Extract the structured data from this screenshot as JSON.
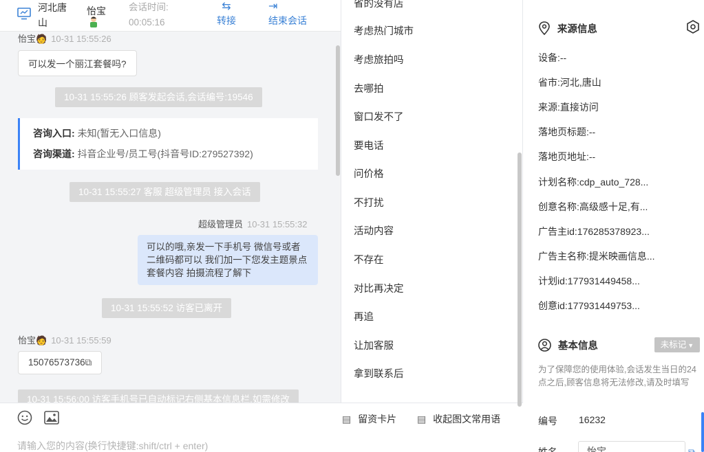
{
  "topbar": {
    "location": "河北唐山",
    "visitor_name": "怡宝",
    "session_time_label": "会话时间:",
    "session_time_value": "00:05:16",
    "transfer_label": "转接",
    "end_label": "结束会话"
  },
  "chat": {
    "msg1_sender": "怡宝",
    "msg1_time": "10-31 15:55:26",
    "msg1_text": "可以发一个丽江套餐吗?",
    "sys1": "10-31 15:55:26 顾客发起会话,会话编号:19546",
    "info_entry_label": "咨询入口:",
    "info_entry_value": "未知(暂无入口信息)",
    "info_channel_label": "咨询渠道:",
    "info_channel_value": "抖音企业号/员工号(抖音号ID:279527392)",
    "sys2": "10-31 15:55:27 客服 超级管理员 接入会话",
    "agent_name": "超级管理员",
    "agent_time": "10-31 15:55:32",
    "agent_text": "可以的哦,亲发一下手机号 微信号或者二维码都可以 我们加一下您发主题景点 套餐内容 拍摄流程了解下",
    "sys3": "10-31 15:55:52 访客已离开",
    "msg2_sender": "怡宝",
    "msg2_time": "10-31 15:55:59",
    "msg2_text": "15076573736",
    "sys4": "10-31 15:56:00 访客手机号已自动标记右侧基本信息栏,如需修改"
  },
  "composer": {
    "placeholder": "请输入您的内容(换行快捷键:shift/ctrl + enter)",
    "card_label": "留资卡片",
    "collapse_label": "收起图文常用语"
  },
  "phrases": {
    "items": [
      "省的没有店",
      "考虑热门城市",
      "考虑旅拍吗",
      "去哪拍",
      "窗口发不了",
      "要电话",
      "问价格",
      "不打扰",
      "活动内容",
      "不存在",
      "对比再决定",
      "再追",
      "让加客服",
      "拿到联系后"
    ]
  },
  "source": {
    "title": "来源信息",
    "device": "设备:--",
    "province": "省市:河北,唐山",
    "origin": "来源:直接访问",
    "landing_title": "落地页标题:--",
    "landing_url": "落地页地址:--",
    "plan_name": "计划名称:cdp_auto_728...",
    "creative_name": "创意名称:高级感十足,有...",
    "advertiser_id": "广告主id:176285378923...",
    "advertiser_name": "广告主名称:提米映画信息...",
    "plan_id": "计划id:177931449458...",
    "creative_id": "创意id:177931449753..."
  },
  "basic": {
    "title": "基本信息",
    "tag_label": "未标记",
    "note": "为了保障您的使用体验,会话发生当日的24点之后,顾客信息将无法修改,请及时填写",
    "number_label": "编号",
    "number_value": "16232",
    "name_label": "姓名",
    "name_value": "怡宝"
  },
  "colors": {
    "accent": "#3b82d6",
    "agent_bubble": "#dbe7fb",
    "system_msg": "#d9d9d9"
  }
}
